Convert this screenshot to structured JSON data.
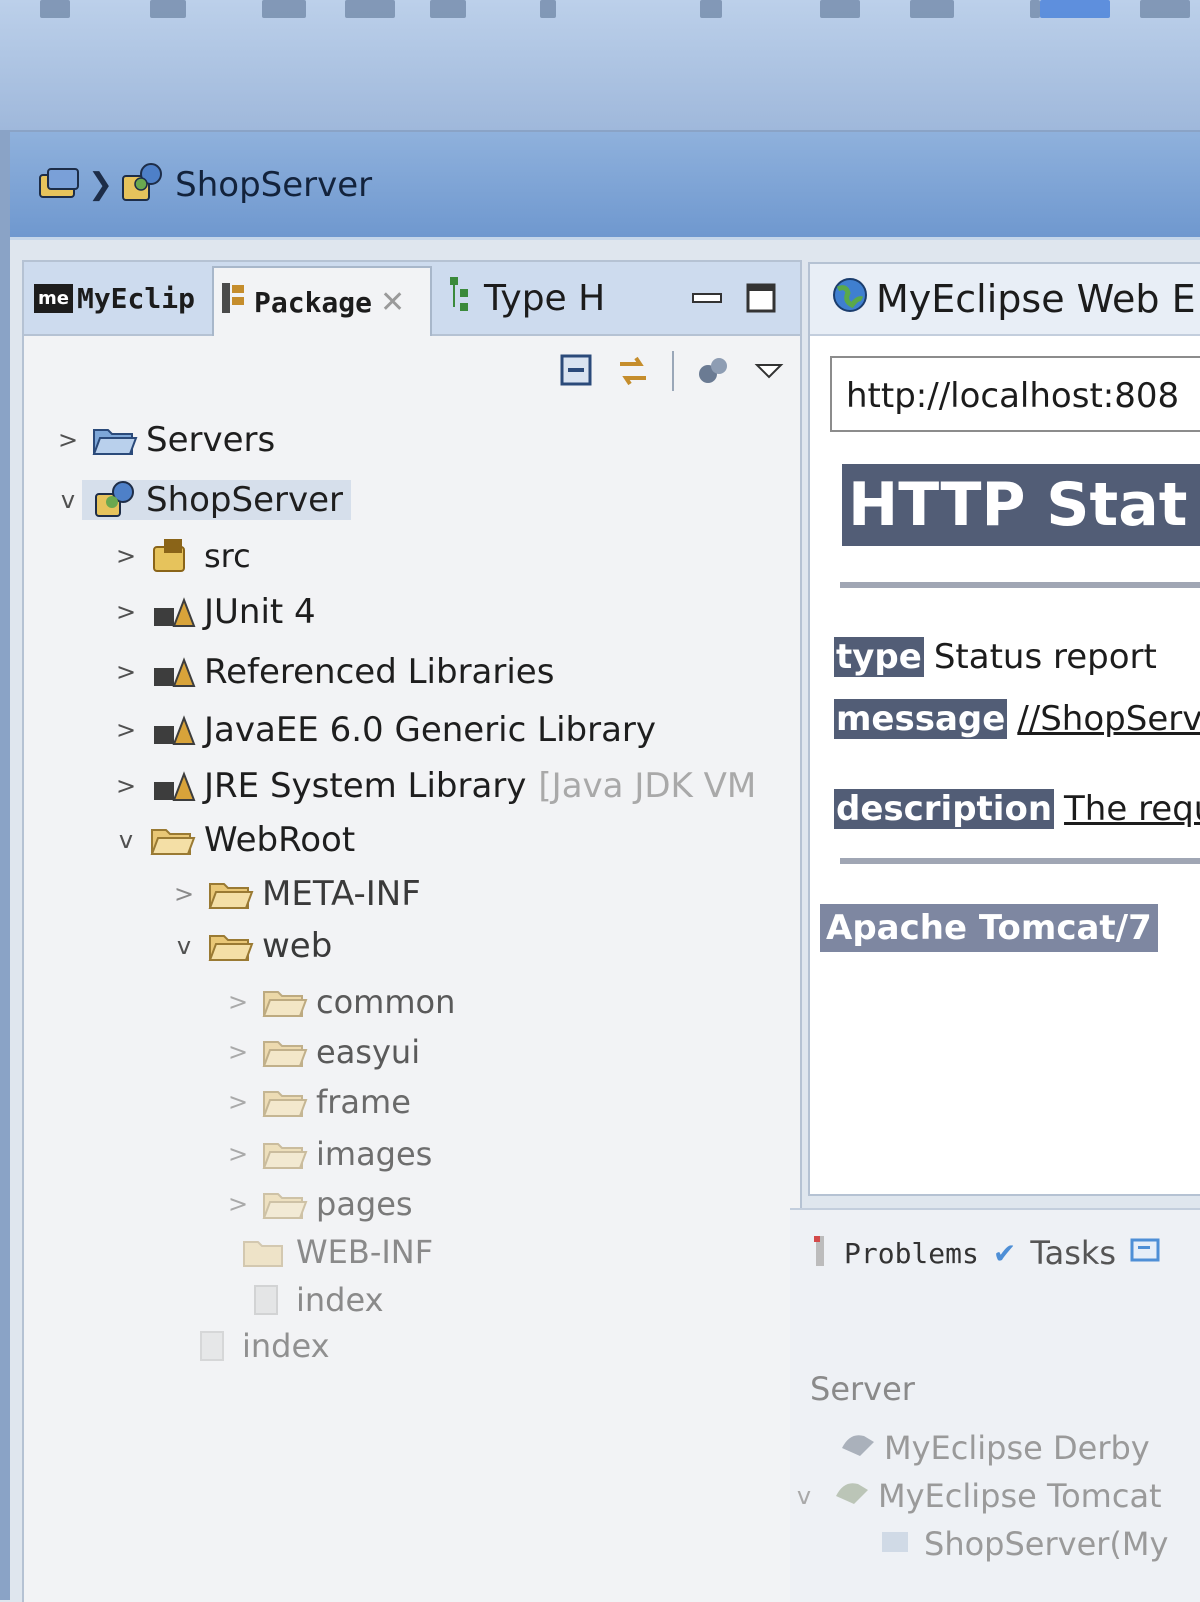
{
  "breadcrumb": {
    "label": "ShopServer"
  },
  "explorer": {
    "tabs": [
      {
        "label": "MyEclip",
        "badge": "me"
      },
      {
        "label": "Package"
      },
      {
        "label": "Type H"
      }
    ],
    "tree": [
      {
        "label": "Servers",
        "chevron": ">",
        "icon": "folder"
      },
      {
        "label": "ShopServer",
        "chevron": "v",
        "icon": "project"
      },
      {
        "label": "src",
        "chevron": ">",
        "icon": "package"
      },
      {
        "label": "JUnit 4",
        "chevron": ">",
        "icon": "library"
      },
      {
        "label": "Referenced Libraries",
        "chevron": ">",
        "icon": "library"
      },
      {
        "label": "JavaEE 6.0 Generic Library",
        "chevron": ">",
        "icon": "library"
      },
      {
        "label": "JRE System Library",
        "suffix": "[Java JDK VM",
        "chevron": ">",
        "icon": "library"
      },
      {
        "label": "WebRoot",
        "chevron": "v",
        "icon": "folder"
      },
      {
        "label": "META-INF",
        "chevron": ">",
        "icon": "folder"
      },
      {
        "label": "web",
        "chevron": "v",
        "icon": "folder"
      },
      {
        "label": "common",
        "chevron": ">",
        "icon": "folder"
      },
      {
        "label": "easyui",
        "chevron": ">",
        "icon": "folder"
      },
      {
        "label": "frame",
        "chevron": ">",
        "icon": "folder"
      },
      {
        "label": "images",
        "chevron": ">",
        "icon": "folder"
      },
      {
        "label": "pages",
        "chevron": ">",
        "icon": "folder"
      },
      {
        "label": "WEB-INF",
        "chevron": "",
        "icon": "folder"
      },
      {
        "label": "index",
        "chevron": "",
        "icon": "file"
      },
      {
        "label": "index",
        "chevron": "",
        "icon": "file"
      }
    ]
  },
  "browser": {
    "tab_label": "MyEclipse Web E",
    "url": "http://localhost:808",
    "heading": "HTTP Stat",
    "type_key": "type",
    "type_value": "Status report",
    "message_key": "message",
    "message_value": "//ShopServe",
    "description_key": "description",
    "description_value": "The requ",
    "footer": "Apache Tomcat/7"
  },
  "bottom": {
    "problems_tab": "Problems",
    "tasks_tab": "Tasks",
    "server_header": "Server",
    "servers": [
      {
        "label": "MyEclipse Derby"
      },
      {
        "label": "MyEclipse Tomcat"
      },
      {
        "label": "ShopServer(My"
      }
    ]
  },
  "colors": {
    "tomcat_header": "#525d76",
    "toolbar": "#9fb8db",
    "folder": "#e2b24a"
  }
}
